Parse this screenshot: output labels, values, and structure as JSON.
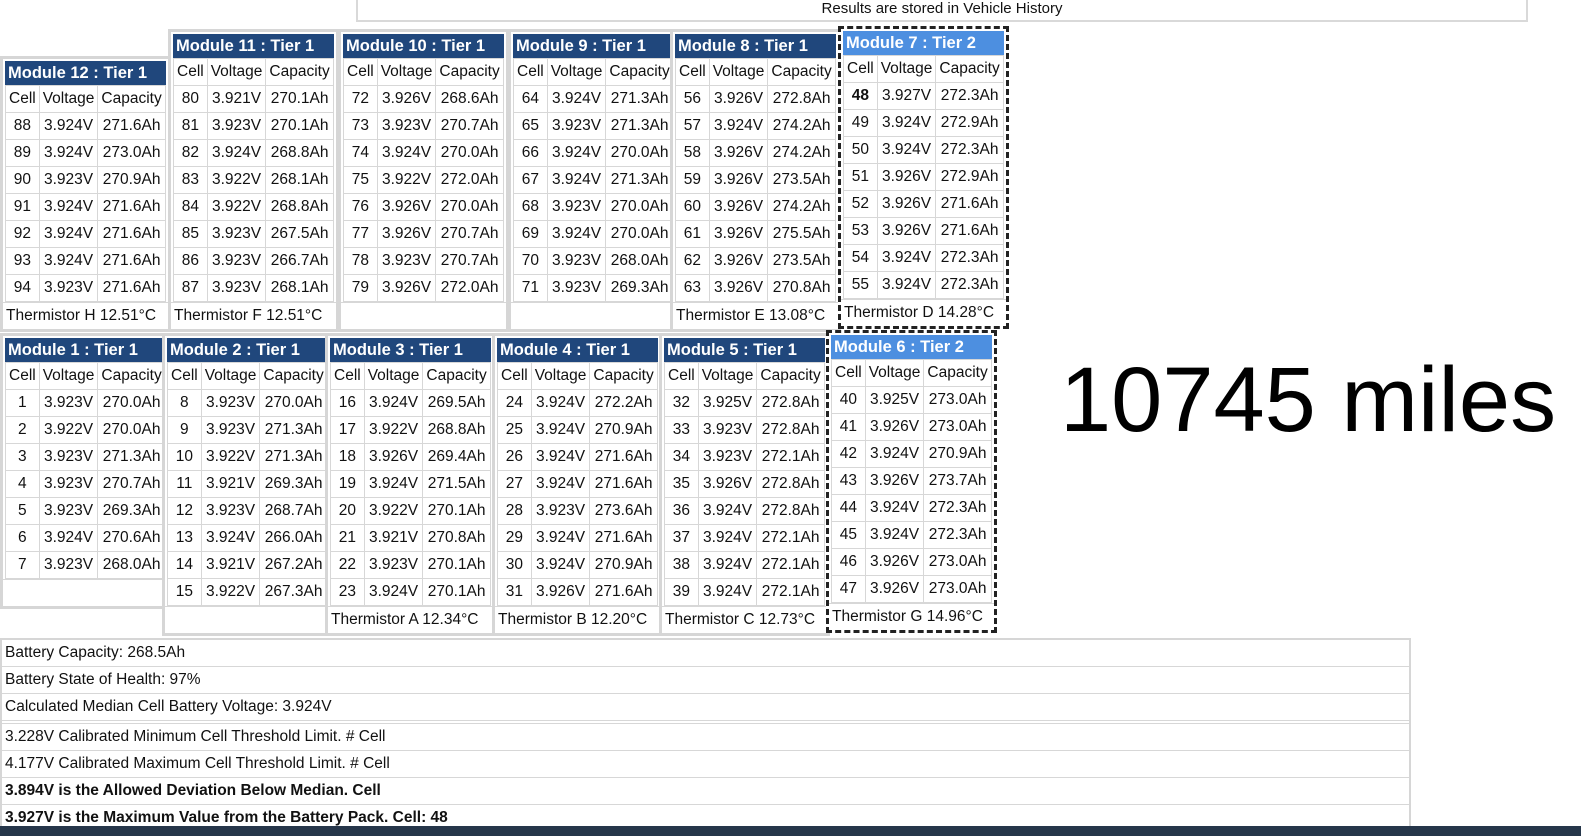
{
  "banner": "Results are stored in Vehicle History",
  "headers": {
    "cell": "Cell",
    "voltage": "Voltage",
    "capacity": "Capacity"
  },
  "mileage": "10745 miles",
  "modules": [
    {
      "id": "m12",
      "title": "Module 12 : Tier 1",
      "thermistor": "Thermistor H 12.51°C",
      "rows": [
        [
          "88",
          "3.924V",
          "271.6Ah"
        ],
        [
          "89",
          "3.924V",
          "273.0Ah"
        ],
        [
          "90",
          "3.923V",
          "270.9Ah"
        ],
        [
          "91",
          "3.924V",
          "271.6Ah"
        ],
        [
          "92",
          "3.924V",
          "271.6Ah"
        ],
        [
          "93",
          "3.924V",
          "271.6Ah"
        ],
        [
          "94",
          "3.923V",
          "271.6Ah"
        ]
      ]
    },
    {
      "id": "m11",
      "title": "Module 11 : Tier 1",
      "thermistor": "Thermistor F 12.51°C",
      "rows": [
        [
          "80",
          "3.921V",
          "270.1Ah"
        ],
        [
          "81",
          "3.923V",
          "270.1Ah"
        ],
        [
          "82",
          "3.924V",
          "268.8Ah"
        ],
        [
          "83",
          "3.922V",
          "268.1Ah"
        ],
        [
          "84",
          "3.922V",
          "268.8Ah"
        ],
        [
          "85",
          "3.923V",
          "267.5Ah"
        ],
        [
          "86",
          "3.923V",
          "266.7Ah"
        ],
        [
          "87",
          "3.923V",
          "268.1Ah"
        ]
      ]
    },
    {
      "id": "m10",
      "title": "Module 10 : Tier 1",
      "thermistor": "",
      "rows": [
        [
          "72",
          "3.926V",
          "268.6Ah"
        ],
        [
          "73",
          "3.923V",
          "270.7Ah"
        ],
        [
          "74",
          "3.924V",
          "270.0Ah"
        ],
        [
          "75",
          "3.922V",
          "272.0Ah"
        ],
        [
          "76",
          "3.926V",
          "270.0Ah"
        ],
        [
          "77",
          "3.926V",
          "270.7Ah"
        ],
        [
          "78",
          "3.923V",
          "270.7Ah"
        ],
        [
          "79",
          "3.926V",
          "272.0Ah"
        ]
      ]
    },
    {
      "id": "m9",
      "title": "Module 9 : Tier 1",
      "thermistor": "",
      "rows": [
        [
          "64",
          "3.924V",
          "271.3Ah"
        ],
        [
          "65",
          "3.923V",
          "271.3Ah"
        ],
        [
          "66",
          "3.924V",
          "270.0Ah"
        ],
        [
          "67",
          "3.924V",
          "271.3Ah"
        ],
        [
          "68",
          "3.923V",
          "270.0Ah"
        ],
        [
          "69",
          "3.924V",
          "270.0Ah"
        ],
        [
          "70",
          "3.923V",
          "268.0Ah"
        ],
        [
          "71",
          "3.923V",
          "269.3Ah"
        ]
      ]
    },
    {
      "id": "m8",
      "title": "Module 8 : Tier 1",
      "thermistor": "Thermistor E 13.08°C",
      "rows": [
        [
          "56",
          "3.926V",
          "272.8Ah"
        ],
        [
          "57",
          "3.924V",
          "274.2Ah"
        ],
        [
          "58",
          "3.926V",
          "274.2Ah"
        ],
        [
          "59",
          "3.926V",
          "273.5Ah"
        ],
        [
          "60",
          "3.926V",
          "274.2Ah"
        ],
        [
          "61",
          "3.926V",
          "275.5Ah"
        ],
        [
          "62",
          "3.926V",
          "273.5Ah"
        ],
        [
          "63",
          "3.926V",
          "270.8Ah"
        ]
      ]
    },
    {
      "id": "m7",
      "title": "Module 7 : Tier 2",
      "thermistor": "Thermistor D 14.28°C",
      "rows": [
        [
          "48",
          "3.927V",
          "272.3Ah"
        ],
        [
          "49",
          "3.924V",
          "272.9Ah"
        ],
        [
          "50",
          "3.924V",
          "272.3Ah"
        ],
        [
          "51",
          "3.926V",
          "272.9Ah"
        ],
        [
          "52",
          "3.926V",
          "271.6Ah"
        ],
        [
          "53",
          "3.926V",
          "271.6Ah"
        ],
        [
          "54",
          "3.924V",
          "272.3Ah"
        ],
        [
          "55",
          "3.924V",
          "272.3Ah"
        ]
      ]
    },
    {
      "id": "m1",
      "title": "Module 1 : Tier 1",
      "thermistor": "",
      "rows": [
        [
          "1",
          "3.923V",
          "270.0Ah"
        ],
        [
          "2",
          "3.922V",
          "270.0Ah"
        ],
        [
          "3",
          "3.923V",
          "271.3Ah"
        ],
        [
          "4",
          "3.923V",
          "270.7Ah"
        ],
        [
          "5",
          "3.923V",
          "269.3Ah"
        ],
        [
          "6",
          "3.924V",
          "270.6Ah"
        ],
        [
          "7",
          "3.923V",
          "268.0Ah"
        ]
      ]
    },
    {
      "id": "m2",
      "title": "Module 2 : Tier 1",
      "thermistor": "",
      "rows": [
        [
          "8",
          "3.923V",
          "270.0Ah"
        ],
        [
          "9",
          "3.923V",
          "271.3Ah"
        ],
        [
          "10",
          "3.922V",
          "271.3Ah"
        ],
        [
          "11",
          "3.921V",
          "269.3Ah"
        ],
        [
          "12",
          "3.923V",
          "268.7Ah"
        ],
        [
          "13",
          "3.924V",
          "266.0Ah"
        ],
        [
          "14",
          "3.921V",
          "267.2Ah"
        ],
        [
          "15",
          "3.922V",
          "267.3Ah"
        ]
      ]
    },
    {
      "id": "m3",
      "title": "Module 3 : Tier 1",
      "thermistor": "Thermistor A 12.34°C",
      "rows": [
        [
          "16",
          "3.924V",
          "269.5Ah"
        ],
        [
          "17",
          "3.922V",
          "268.8Ah"
        ],
        [
          "18",
          "3.926V",
          "269.4Ah"
        ],
        [
          "19",
          "3.924V",
          "271.5Ah"
        ],
        [
          "20",
          "3.922V",
          "270.1Ah"
        ],
        [
          "21",
          "3.921V",
          "270.8Ah"
        ],
        [
          "22",
          "3.923V",
          "270.1Ah"
        ],
        [
          "23",
          "3.924V",
          "270.1Ah"
        ]
      ]
    },
    {
      "id": "m4",
      "title": "Module 4 : Tier 1",
      "thermistor": "Thermistor B 12.20°C",
      "rows": [
        [
          "24",
          "3.924V",
          "272.2Ah"
        ],
        [
          "25",
          "3.924V",
          "270.9Ah"
        ],
        [
          "26",
          "3.924V",
          "271.6Ah"
        ],
        [
          "27",
          "3.924V",
          "271.6Ah"
        ],
        [
          "28",
          "3.923V",
          "273.6Ah"
        ],
        [
          "29",
          "3.924V",
          "271.6Ah"
        ],
        [
          "30",
          "3.924V",
          "270.9Ah"
        ],
        [
          "31",
          "3.926V",
          "271.6Ah"
        ]
      ]
    },
    {
      "id": "m5",
      "title": "Module 5 : Tier 1",
      "thermistor": "Thermistor C 12.73°C",
      "rows": [
        [
          "32",
          "3.925V",
          "272.8Ah"
        ],
        [
          "33",
          "3.923V",
          "272.8Ah"
        ],
        [
          "34",
          "3.923V",
          "272.1Ah"
        ],
        [
          "35",
          "3.926V",
          "272.8Ah"
        ],
        [
          "36",
          "3.924V",
          "272.8Ah"
        ],
        [
          "37",
          "3.924V",
          "272.1Ah"
        ],
        [
          "38",
          "3.924V",
          "272.1Ah"
        ],
        [
          "39",
          "3.924V",
          "272.1Ah"
        ]
      ]
    },
    {
      "id": "m6",
      "title": "Module 6 : Tier 2",
      "thermistor": "Thermistor G 14.96°C",
      "rows": [
        [
          "40",
          "3.925V",
          "273.0Ah"
        ],
        [
          "41",
          "3.926V",
          "273.0Ah"
        ],
        [
          "42",
          "3.924V",
          "270.9Ah"
        ],
        [
          "43",
          "3.926V",
          "273.7Ah"
        ],
        [
          "44",
          "3.924V",
          "272.3Ah"
        ],
        [
          "45",
          "3.924V",
          "272.3Ah"
        ],
        [
          "46",
          "3.926V",
          "273.0Ah"
        ],
        [
          "47",
          "3.926V",
          "273.0Ah"
        ]
      ]
    }
  ],
  "summary": {
    "capacity": "Battery Capacity: 268.5Ah",
    "soh": "Battery State of Health: 97%",
    "median": "Calculated Median Cell Battery Voltage: 3.924V",
    "min_threshold": "3.228V Calibrated Minimum Cell Threshold Limit. # Cell",
    "max_threshold": "4.177V Calibrated Maximum Cell Threshold Limit. # Cell",
    "deviation": "3.894V is the Allowed Deviation Below Median. Cell",
    "maximum": "3.927V is the Maximum Value from the Battery Pack. Cell: 48"
  }
}
